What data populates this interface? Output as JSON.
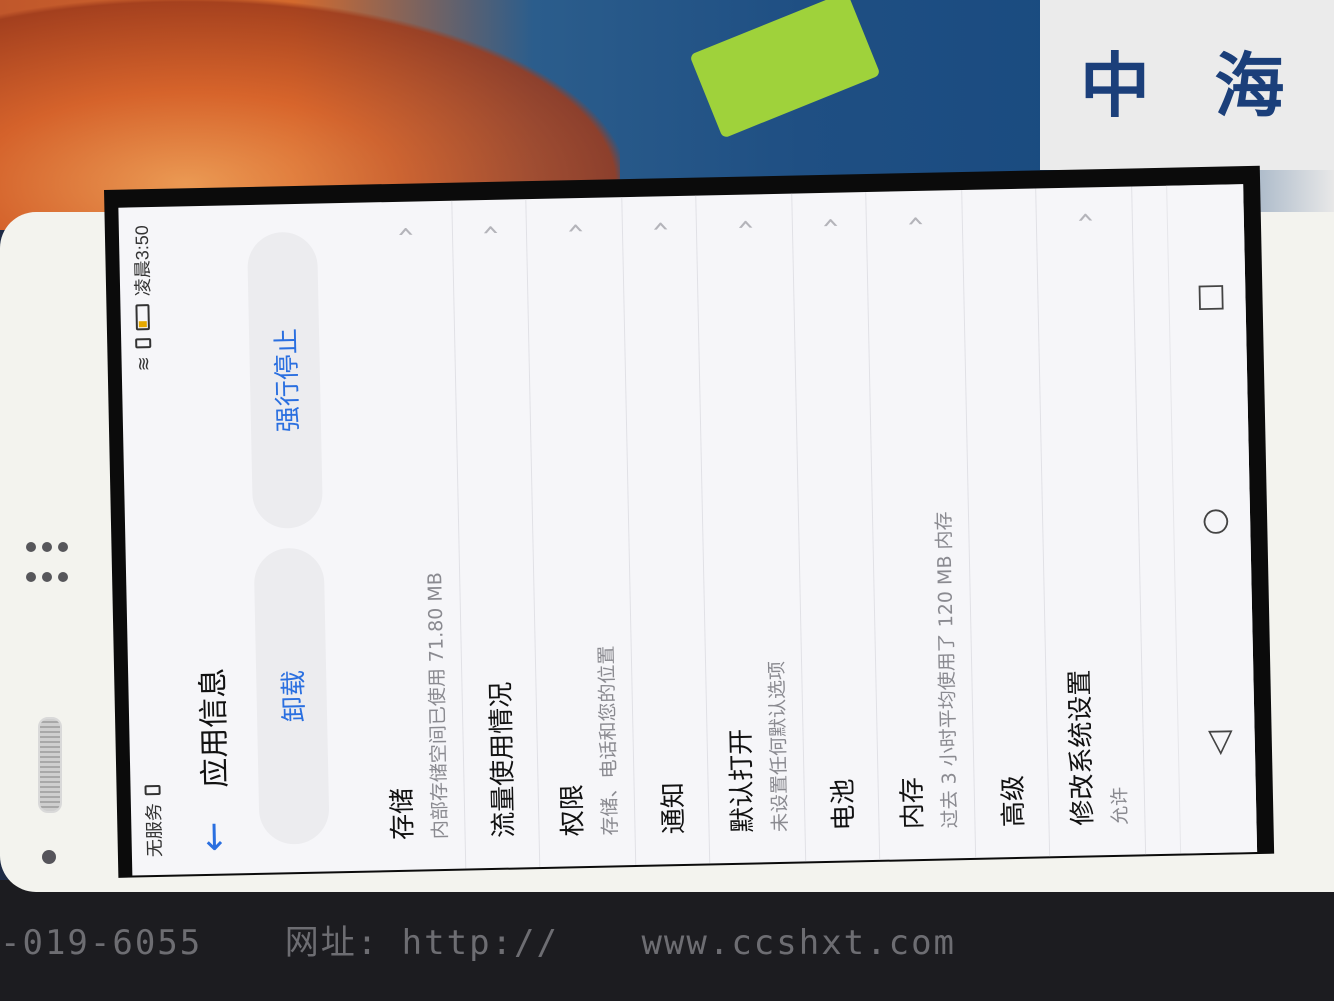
{
  "background": {
    "poster_text": "中 海",
    "mat_text": [
      "-019-6055",
      "网址: http://",
      "www.ccshxt.com"
    ]
  },
  "statusbar": {
    "carrier": "无服务",
    "time": "凌晨3:50",
    "icons": [
      "wifi-icon",
      "sim-icon",
      "battery-icon"
    ]
  },
  "header": {
    "back_icon": "arrow-left-icon",
    "title": "应用信息"
  },
  "actions": {
    "uninstall_label": "卸载",
    "force_stop_label": "强行停止"
  },
  "settings": [
    {
      "label": "存储",
      "sub": "内部存储空间已使用 71.80 MB"
    },
    {
      "label": "流量使用情况",
      "sub": ""
    },
    {
      "label": "权限",
      "sub": "存储、电话和您的位置"
    },
    {
      "label": "通知",
      "sub": ""
    },
    {
      "label": "默认打开",
      "sub": "未设置任何默认选项"
    },
    {
      "label": "电池",
      "sub": ""
    },
    {
      "label": "内存",
      "sub": "过去 3 小时平均使用了 120 MB 内存"
    },
    {
      "label": "高级",
      "sub": ""
    },
    {
      "label": "修改系统设置",
      "sub": "允许"
    }
  ],
  "navbar": {
    "back_icon": "triangle-back-icon",
    "home_icon": "circle-home-icon",
    "recents_icon": "square-recents-icon"
  },
  "colors": {
    "accent": "#2a6fe0",
    "screen_bg": "#f6f6f9"
  }
}
